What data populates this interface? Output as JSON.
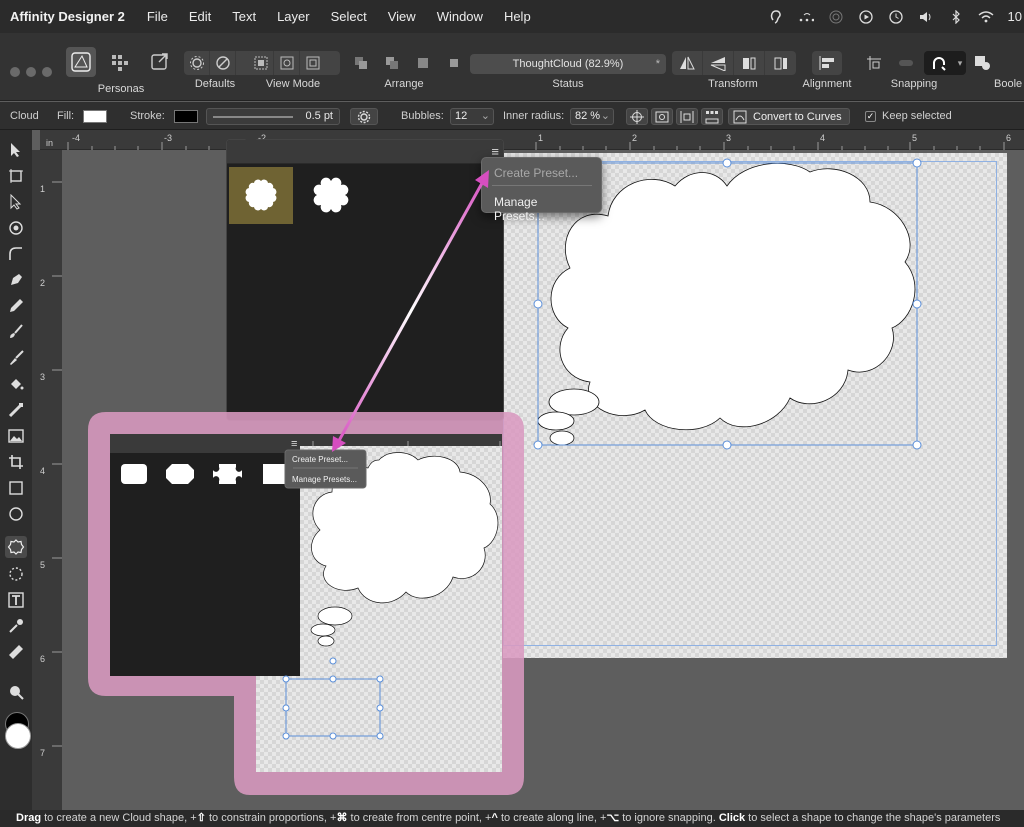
{
  "menubar": {
    "app_name": "Affinity Designer 2",
    "items": [
      "File",
      "Edit",
      "Text",
      "Layer",
      "Select",
      "View",
      "Window",
      "Help"
    ],
    "clock": "10"
  },
  "toolbar": {
    "personas_label": "Personas",
    "defaults_label": "Defaults",
    "view_mode_label": "View Mode",
    "arrange_label": "Arrange",
    "status_label": "Status",
    "status_value": "ThoughtCloud (82.9%)",
    "status_modified": "*",
    "transform_label": "Transform",
    "alignment_label": "Alignment",
    "snapping_label": "Snapping",
    "boole_label": "Boole"
  },
  "context": {
    "shape_name": "Cloud",
    "fill_label": "Fill:",
    "fill_color": "#ffffff",
    "stroke_label": "Stroke:",
    "stroke_color": "#000000",
    "stroke_width": "0.5 pt",
    "bubbles_label": "Bubbles:",
    "bubbles_value": "12",
    "inner_radius_label": "Inner radius:",
    "inner_radius_value": "82 %",
    "convert_label": "Convert to Curves",
    "keep_selected_label": "Keep selected"
  },
  "ruler": {
    "unit": "in",
    "top_ticks": [
      "-4",
      "-3",
      "-2",
      "1",
      "2",
      "3",
      "4",
      "5",
      "6"
    ],
    "left_ticks": [
      "1",
      "2",
      "3",
      "4",
      "5",
      "6",
      "7"
    ]
  },
  "preset_menu": {
    "create": "Create Preset...",
    "manage": "Manage Presets..."
  },
  "inset": {
    "create": "Create Preset...",
    "manage": "Manage Presets..."
  },
  "colors": {
    "accent_selection": "#5b8fd9",
    "arrow": "#d64ec0",
    "inset_frame": "#d99ac0",
    "preset_selected": "#6f6333"
  },
  "statusbar": {
    "text_parts": [
      {
        "b": "Drag"
      },
      {
        "t": " to create a new Cloud shape, +"
      },
      {
        "b": "⇧"
      },
      {
        "t": " to constrain proportions, +"
      },
      {
        "b": "⌘"
      },
      {
        "t": " to create from centre point, +"
      },
      {
        "b": "^"
      },
      {
        "t": " to create along line, +"
      },
      {
        "b": "⌥"
      },
      {
        "t": " to ignore snapping. "
      },
      {
        "b": "Click"
      },
      {
        "t": " to select a shape to change the shape's parameters"
      }
    ]
  }
}
